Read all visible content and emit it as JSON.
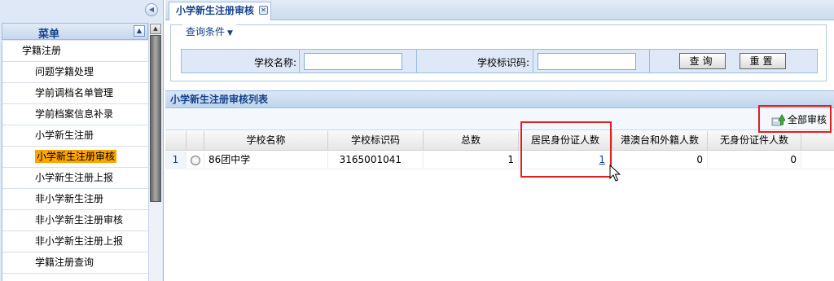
{
  "sidebar": {
    "menu_title": "菜单",
    "items": [
      {
        "label": "学籍注册",
        "group": true
      },
      {
        "label": "问题学籍处理"
      },
      {
        "label": "学前调档名单管理"
      },
      {
        "label": "学前档案信息补录"
      },
      {
        "label": "小学新生注册"
      },
      {
        "label": "小学新生注册审核",
        "active": true
      },
      {
        "label": "小学新生注册上报"
      },
      {
        "label": "非小学新生注册"
      },
      {
        "label": "非小学新生注册审核"
      },
      {
        "label": "非小学新生注册上报"
      },
      {
        "label": "学籍注册查询"
      }
    ]
  },
  "tab": {
    "title": "小学新生注册审核"
  },
  "query": {
    "legend": "查询条件",
    "school_name_label": "学校名称:",
    "school_name_value": "",
    "school_id_label": "学校标识码:",
    "school_id_value": "",
    "search_button": "查询",
    "reset_button": "重置"
  },
  "list": {
    "title": "小学新生注册审核列表",
    "approve_all": "全部审核",
    "columns": [
      "学校名称",
      "学校标识码",
      "总数",
      "居民身份证人数",
      "港澳台和外籍人数",
      "无身份证件人数"
    ],
    "rows": [
      {
        "num": "1",
        "school_name": "86团中学",
        "school_id": "3165001041",
        "total": "1",
        "resident_id": "1",
        "hk_macao_tw": "0",
        "no_id": "0"
      }
    ]
  },
  "colors": {
    "highlight": "#e02020",
    "active_menu": "#ffa500",
    "accent": "#15428b"
  }
}
